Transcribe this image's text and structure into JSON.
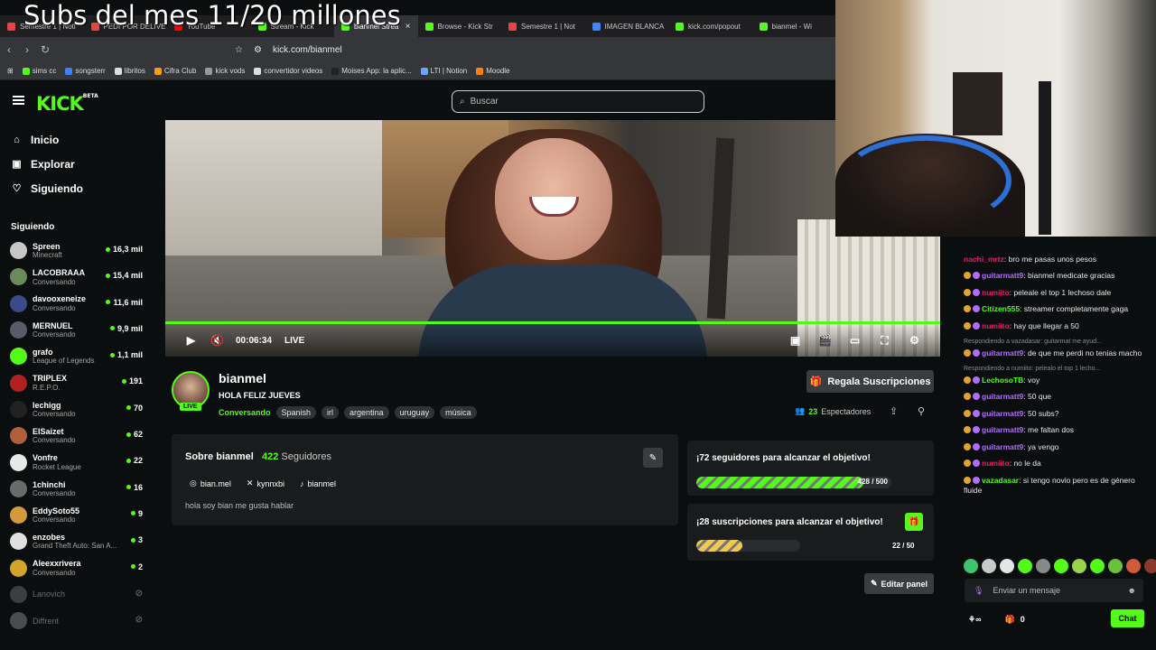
{
  "overlay": {
    "title": "Subs del mes 11/20 millones"
  },
  "browser": {
    "tabs": [
      {
        "label": "Semestre 1 | Noti",
        "color": "#e94444"
      },
      {
        "label": "PEDI POR DELIVE",
        "color": "#e94444"
      },
      {
        "label": "YouTube",
        "color": "#ff0000"
      },
      {
        "label": "Stream - Kick",
        "color": "#53fc18"
      },
      {
        "label": "bianmel Strea",
        "color": "#53fc18",
        "active": true
      },
      {
        "label": "Browse - Kick Str",
        "color": "#53fc18"
      },
      {
        "label": "Semestre 1 | Not",
        "color": "#e94444"
      },
      {
        "label": "IMAGEN BLANCA",
        "color": "#4285f4"
      },
      {
        "label": "kick.com/popout",
        "color": "#53fc18"
      },
      {
        "label": "bianmel - Wi",
        "color": "#53fc18"
      }
    ],
    "tab_close": "×",
    "url": "kick.com/bianmel",
    "bookmarks": [
      {
        "label": "sims cc",
        "color": "#53fc18"
      },
      {
        "label": "songsterr",
        "color": "#3b82f6"
      },
      {
        "label": "libritos",
        "color": "#ddd"
      },
      {
        "label": "Cifra Club",
        "color": "#f59e0b"
      },
      {
        "label": "kick vods",
        "color": "#999"
      },
      {
        "label": "convertidor videos",
        "color": "#ddd"
      },
      {
        "label": "Moises App: la aplic...",
        "color": "#222"
      },
      {
        "label": "LTI | Notion",
        "color": "#6aa6ff"
      },
      {
        "label": "Moodle",
        "color": "#f98012"
      }
    ]
  },
  "header": {
    "logo": "KICK",
    "logo_sup": "BETA",
    "search_placeholder": "Buscar"
  },
  "sidebar": {
    "nav": [
      {
        "label": "Inicio",
        "icon": "⌂"
      },
      {
        "label": "Explorar",
        "icon": "▣"
      },
      {
        "label": "Siguiendo",
        "icon": "♡"
      }
    ],
    "section_title": "Siguiendo",
    "channels": [
      {
        "name": "Spreen",
        "category": "Minecraft",
        "viewers": "16,3 mil",
        "color": "#c7c7c7"
      },
      {
        "name": "LACOBRAAA",
        "category": "Conversando",
        "viewers": "15,4 mil",
        "color": "#6a8a5a"
      },
      {
        "name": "davooxeneize",
        "category": "Conversando",
        "viewers": "11,6 mil",
        "color": "#3a4a8a"
      },
      {
        "name": "MERNUEL",
        "category": "Conversando",
        "viewers": "9,9 mil",
        "color": "#5a5a6a"
      },
      {
        "name": "grafo",
        "category": "League of Legends",
        "viewers": "1,1 mil",
        "color": "#53fc18"
      },
      {
        "name": "TRIPLEX",
        "category": "R.E.P.O.",
        "viewers": "191",
        "color": "#b02020"
      },
      {
        "name": "lechigg",
        "category": "Conversando",
        "viewers": "70",
        "color": "#222"
      },
      {
        "name": "ElSaizet",
        "category": "Conversando",
        "viewers": "62",
        "color": "#b0603a"
      },
      {
        "name": "Vonfre",
        "category": "Rocket League",
        "viewers": "22",
        "color": "#e8e8e8"
      },
      {
        "name": "1chinchi",
        "category": "Conversando",
        "viewers": "16",
        "color": "#6a6a6a"
      },
      {
        "name": "EddySoto55",
        "category": "Conversando",
        "viewers": "9",
        "color": "#d49a3a"
      },
      {
        "name": "enzobes",
        "category": "Grand Theft Auto: San A...",
        "viewers": "3",
        "color": "#e0e0e0"
      },
      {
        "name": "Aleexxrivera",
        "category": "Conversando",
        "viewers": "2",
        "color": "#d4a32a"
      }
    ],
    "offline": [
      {
        "name": "Lanovich",
        "color": "#888"
      },
      {
        "name": "Diffrent",
        "color": "#aaa"
      }
    ]
  },
  "player": {
    "time": "00:06:34",
    "live": "LIVE",
    "progress": 1.0
  },
  "channel": {
    "name": "bianmel",
    "live_badge": "LIVE",
    "title": "HOLA FELIZ JUEVES",
    "category": "Conversando",
    "tags": [
      "Spanish",
      "irl",
      "argentina",
      "uruguay",
      "música"
    ],
    "gift_button": "Regala Suscripciones",
    "viewers_count": "23",
    "viewers_label": "Espectadores"
  },
  "about": {
    "title": "Sobre bianmel",
    "followers_count": "422",
    "followers_label": "Seguidores",
    "socials": [
      {
        "icon": "instagram-icon",
        "glyph": "◎",
        "label": "bian.mel"
      },
      {
        "icon": "x-icon",
        "glyph": "✕",
        "label": "kynnxbi"
      },
      {
        "icon": "tiktok-icon",
        "glyph": "♪",
        "label": "bianmel"
      }
    ],
    "bio": "hola soy bian me gusta hablar"
  },
  "goals": [
    {
      "title": "¡72 seguidores para alcanzar el objetivo!",
      "current": 428,
      "target": 500,
      "label": "428 / 500",
      "color": "#53fc18"
    },
    {
      "title": "¡28 suscripciones para alcanzar el objetivo!",
      "current": 22,
      "target": 50,
      "label": "22 / 50",
      "color": "#f2c94c"
    }
  ],
  "edit_panel": "Editar panel",
  "chat": {
    "messages": [
      {
        "user": "nachi_mrtz",
        "color": "#e91e63",
        "text": "bro me pasas unos pesos"
      },
      {
        "user": "guitarmatt9",
        "color": "#b36bff",
        "text": "bianmel medicate gracias",
        "badges": true
      },
      {
        "user": "numiito",
        "color": "#e91e63",
        "text": "peleale el top 1 lechoso dale",
        "badges": true
      },
      {
        "user": "Citizen555",
        "color": "#53fc18",
        "text": "streamer completamente gaga",
        "badges": true
      },
      {
        "user": "numiito",
        "color": "#e91e63",
        "text": "hay que llegar a 50",
        "badges": true
      },
      {
        "reply": "Respondiendo a vazadasar: guitarmat me ayud...",
        "user": "guitarmatt9",
        "color": "#b36bff",
        "text": "de que me perdi no tenias macho",
        "badges": true
      },
      {
        "reply": "Respondiendo a numiito: pelealo el top 1 lecho...",
        "user": "LechosoTB",
        "color": "#53fc18",
        "text": "voy",
        "badges": true
      },
      {
        "user": "guitarmatt9",
        "color": "#b36bff",
        "text": "50 que",
        "badges": true
      },
      {
        "user": "guitarmatt9",
        "color": "#b36bff",
        "text": "50 subs?",
        "badges": true
      },
      {
        "user": "guitarmatt9",
        "color": "#b36bff",
        "text": "me faltan dos",
        "badges": true
      },
      {
        "user": "guitarmatt9",
        "color": "#b36bff",
        "text": "ya vengo",
        "badges": true
      },
      {
        "user": "numiito",
        "color": "#e91e63",
        "text": "no le da",
        "badges": true
      },
      {
        "user": "vazadasar",
        "color": "#53fc18",
        "text": "si tengo novio pero es de género fluide",
        "badges": true
      }
    ],
    "emote_colors": [
      "#3ec46d",
      "#c9c9c9",
      "#e5e5e5",
      "#53fc18",
      "#888",
      "#53fc18",
      "#9bd34a",
      "#53fc18",
      "#6ac13b",
      "#d05a3a",
      "#8a3a2a",
      "#53fc18"
    ],
    "input_placeholder": "Enviar un mensaje",
    "points": "0",
    "send_button": "Chat"
  },
  "colors": {
    "accent": "#53fc18",
    "bg": "#0b0e0f",
    "panel": "#191b1c"
  }
}
